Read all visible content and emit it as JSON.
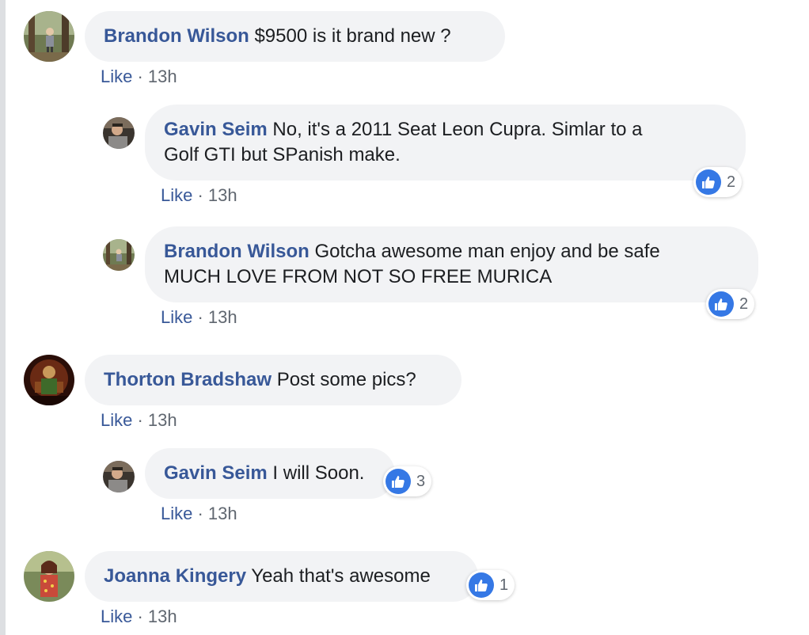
{
  "comments": [
    {
      "author": "Brandon Wilson",
      "text": "$9500 is it brand new ?",
      "like": "Like",
      "sep": " · ",
      "time": "13h"
    },
    {
      "author": "Gavin Seim",
      "text_line1": "No, it's a 2011 Seat Leon Cupra. Simlar to a",
      "text_line2": "Golf GTI but SPanish make.",
      "like": "Like",
      "sep": " · ",
      "time": "13h",
      "reactions": "2"
    },
    {
      "author": "Brandon Wilson",
      "text_line1": "Gotcha awesome man enjoy and be safe",
      "text_line2": "MUCH LOVE FROM NOT SO FREE MURICA",
      "like": "Like",
      "sep": " · ",
      "time": "13h",
      "reactions": "2"
    },
    {
      "author": "Thorton Bradshaw",
      "text": "Post some pics?",
      "like": "Like",
      "sep": " · ",
      "time": "13h"
    },
    {
      "author": "Gavin Seim",
      "text": "I will Soon.",
      "like": "Like",
      "sep": " · ",
      "time": "13h",
      "reactions": "3"
    },
    {
      "author": "Joanna Kingery",
      "text": "Yeah that's awesome",
      "like": "Like",
      "sep": " · ",
      "time": "13h",
      "reactions": "1"
    }
  ],
  "colors": {
    "author_link": "#385898",
    "bubble_bg": "#f2f3f5",
    "meta_text": "#606770",
    "like_reaction": "#3578e5"
  },
  "icons": {
    "reaction": "thumbs-up-icon",
    "avatars": [
      "avatar-photo-forest",
      "avatar-photo-man",
      "avatar-photo-costume",
      "avatar-photo-woman"
    ]
  }
}
